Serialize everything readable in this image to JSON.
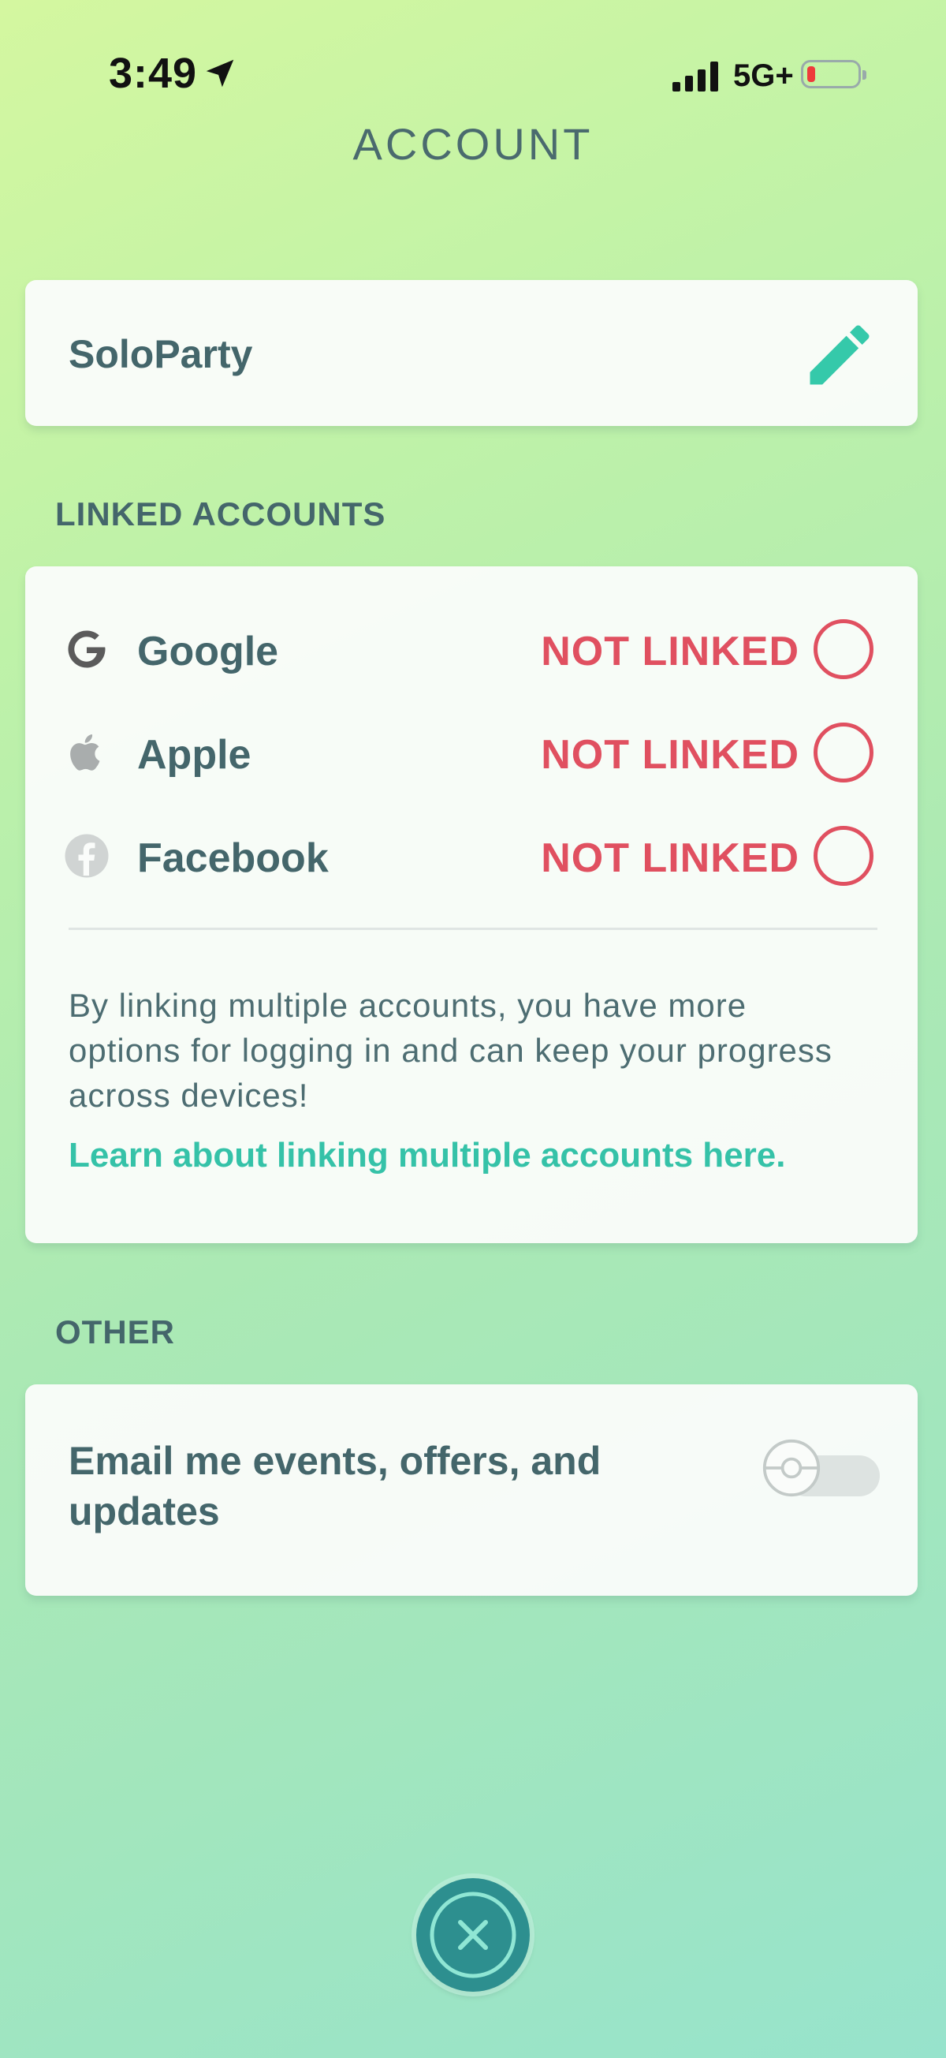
{
  "status_bar": {
    "time": "3:49",
    "network": "5G+"
  },
  "page": {
    "title": "ACCOUNT"
  },
  "profile": {
    "username": "SoloParty"
  },
  "linked_accounts": {
    "section_label": "LINKED ACCOUNTS",
    "accounts": [
      {
        "name": "Google",
        "status": "NOT LINKED",
        "icon": "google-icon"
      },
      {
        "name": "Apple",
        "status": "NOT LINKED",
        "icon": "apple-icon"
      },
      {
        "name": "Facebook",
        "status": "NOT LINKED",
        "icon": "facebook-icon"
      }
    ],
    "info_text": "By linking multiple accounts, you have more options for logging in and can keep your progress across devices!",
    "learn_link": "Learn about linking multiple accounts here."
  },
  "other": {
    "section_label": "OTHER",
    "email_label": "Email me events, offers, and updates",
    "email_enabled": false
  },
  "colors": {
    "accent": "#35c2a8",
    "not_linked": "#e05060",
    "text": "#44666b",
    "close_button": "#2d8f8f"
  }
}
